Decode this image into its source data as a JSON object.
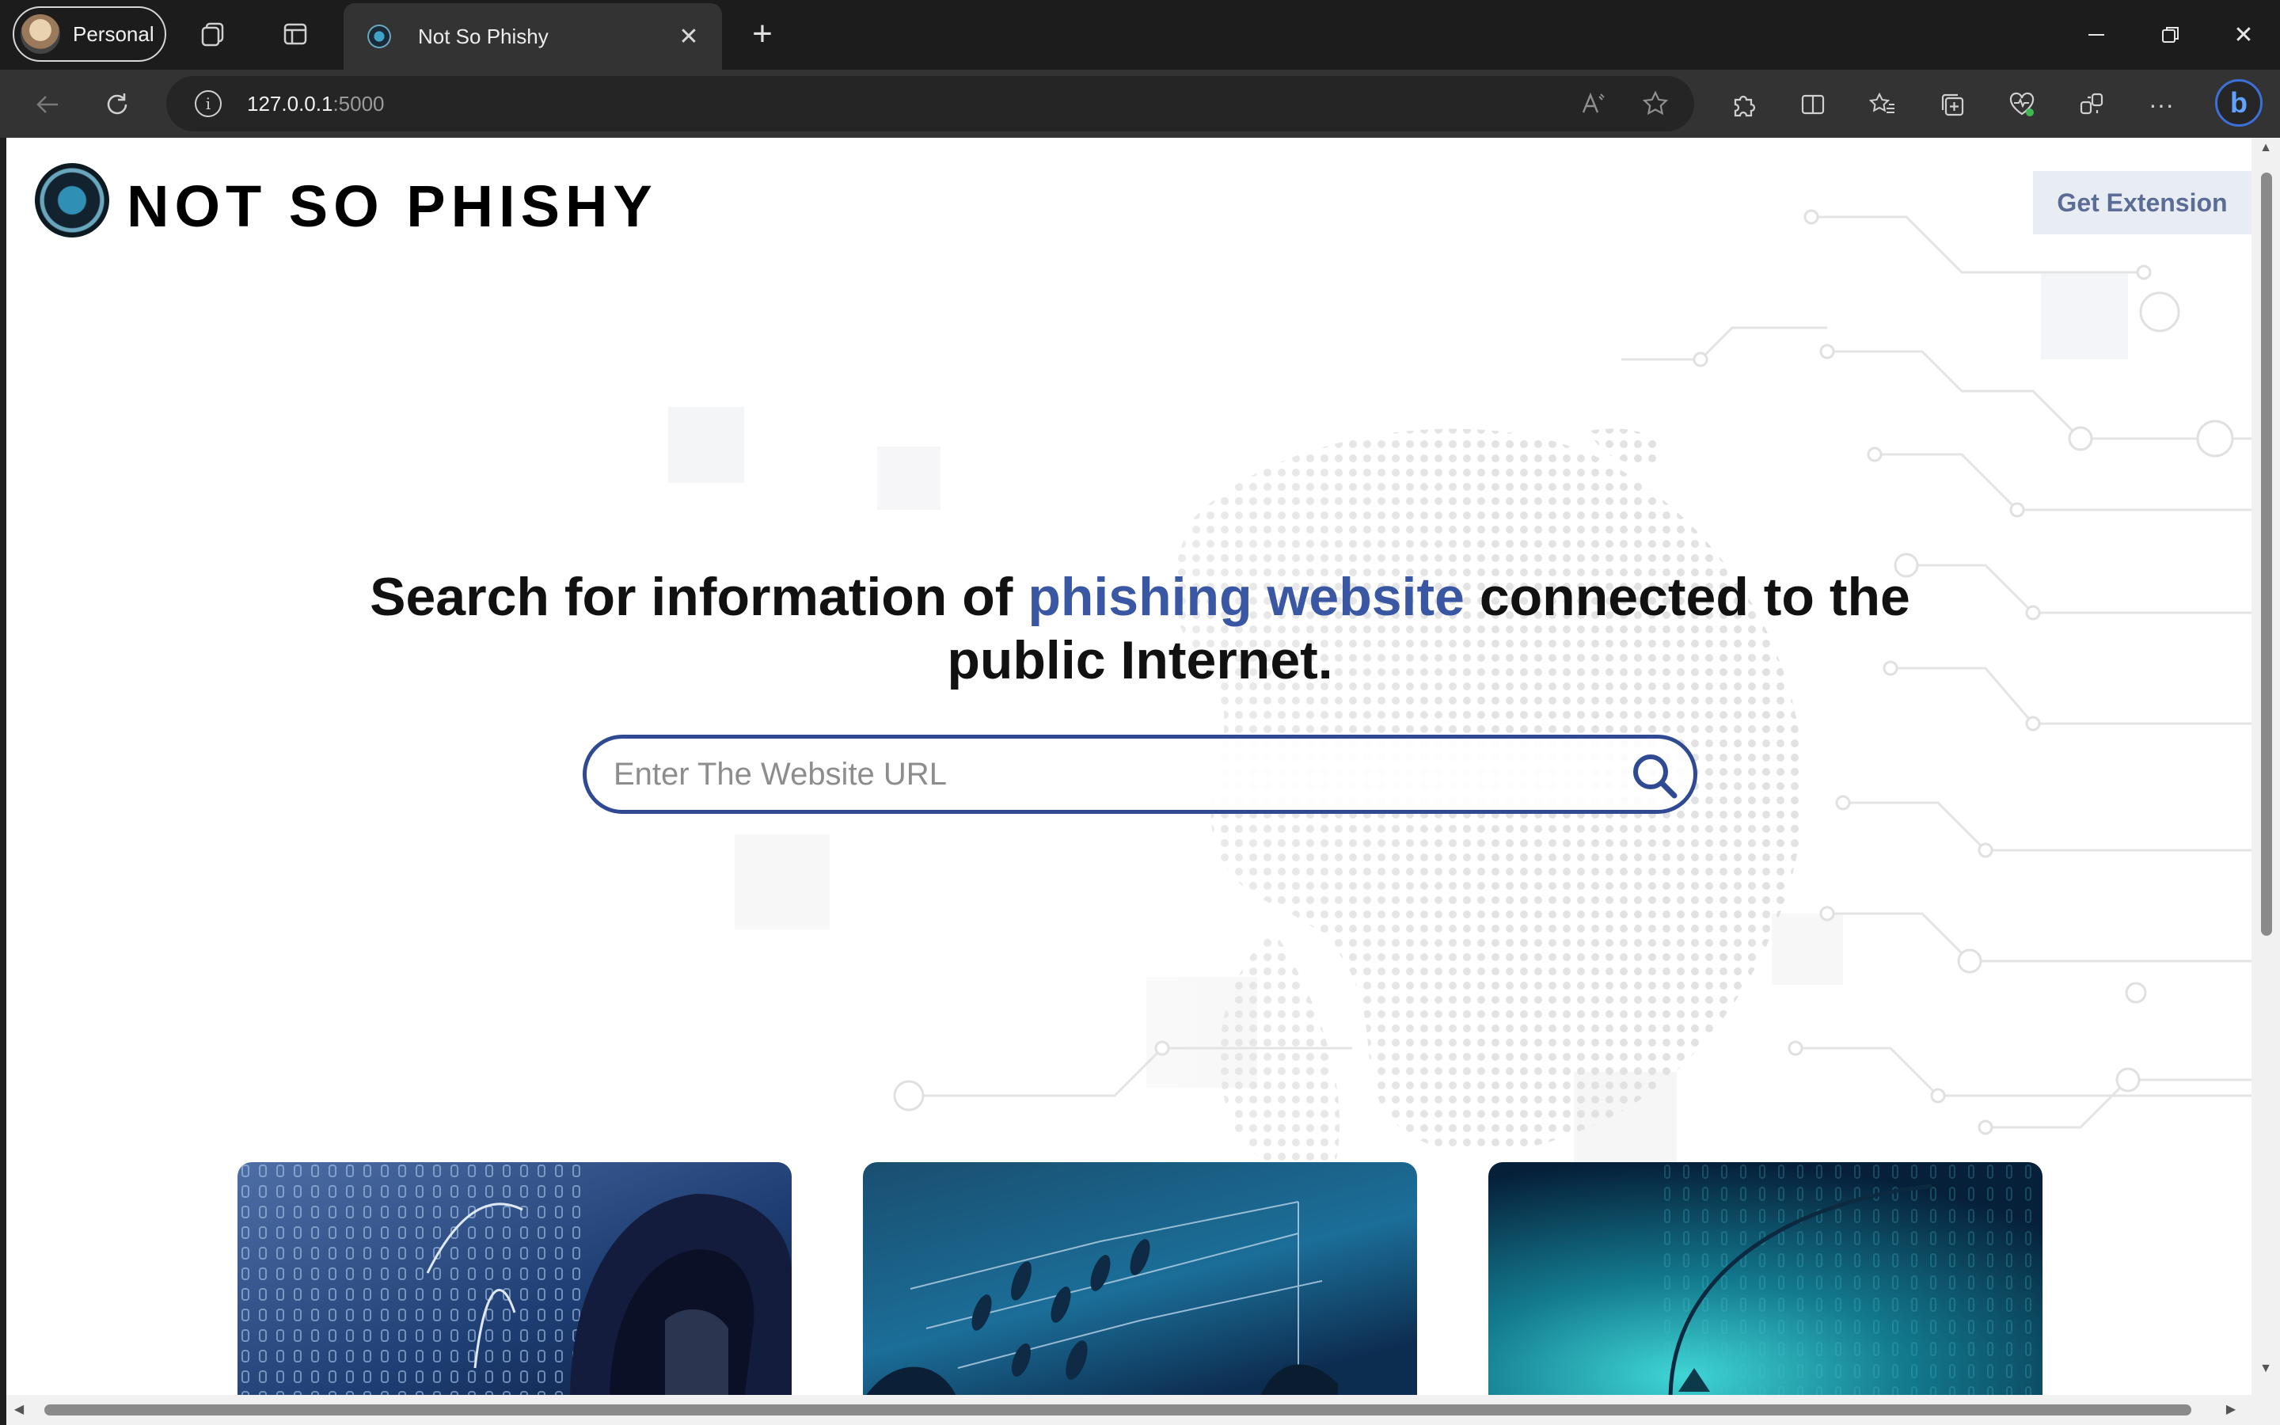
{
  "browser": {
    "profile_label": "Personal",
    "tab_title": "Not So Phishy",
    "url_host": "127.0.0.1",
    "url_port": ":5000"
  },
  "site": {
    "brand": "NOT SO PHISHY",
    "get_extension_label": "Get Extension",
    "hero_prefix": "Search for information of ",
    "hero_accent": "phishing website",
    "hero_suffix_line1": " connected to the",
    "hero_line2": "public Internet.",
    "search_placeholder": "Enter The Website URL",
    "accent_color": "#3a57a4",
    "search_border_color": "#2f4a93"
  },
  "cards": [
    {
      "image": "hooded-hacker-binary-code"
    },
    {
      "image": "fish-on-hooks-dark-blue"
    },
    {
      "image": "fishing-hook-teal-code"
    }
  ]
}
